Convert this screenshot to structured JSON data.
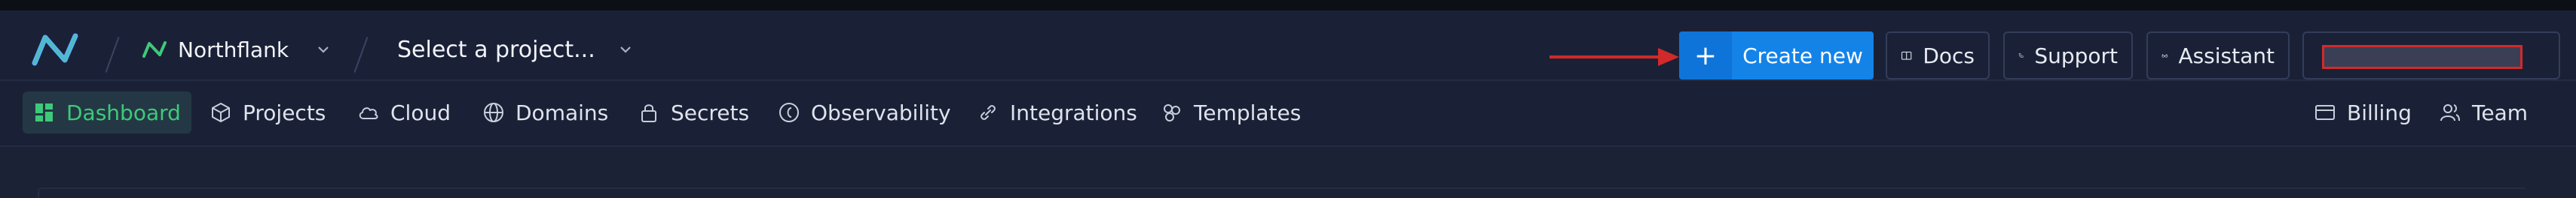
{
  "topbar": {
    "team_name": "Northflank",
    "project_selector": "Select a project...",
    "create_button": "Create new",
    "create_plus": "+",
    "docs": "Docs",
    "support": "Support",
    "assistant": "Assistant"
  },
  "nav": {
    "dashboard": "Dashboard",
    "projects": "Projects",
    "cloud": "Cloud",
    "domains": "Domains",
    "secrets": "Secrets",
    "observability": "Observability",
    "integrations": "Integrations",
    "templates": "Templates",
    "billing": "Billing",
    "team": "Team"
  },
  "colors": {
    "accent_blue": "#1483e8",
    "active_green": "#3ec97a",
    "background": "#1a2137",
    "annotation_red": "#d22a2a"
  },
  "icons": [
    "northflank-logo-icon",
    "chevron-down-icon",
    "plus-icon",
    "book-icon",
    "phone-icon",
    "glasses-icon",
    "grid-icon",
    "cube-icon",
    "cloud-icon",
    "globe-icon",
    "lock-icon",
    "observability-icon",
    "link-icon",
    "templates-icon",
    "credit-card-icon",
    "users-icon",
    "arrow-annotation-icon"
  ]
}
